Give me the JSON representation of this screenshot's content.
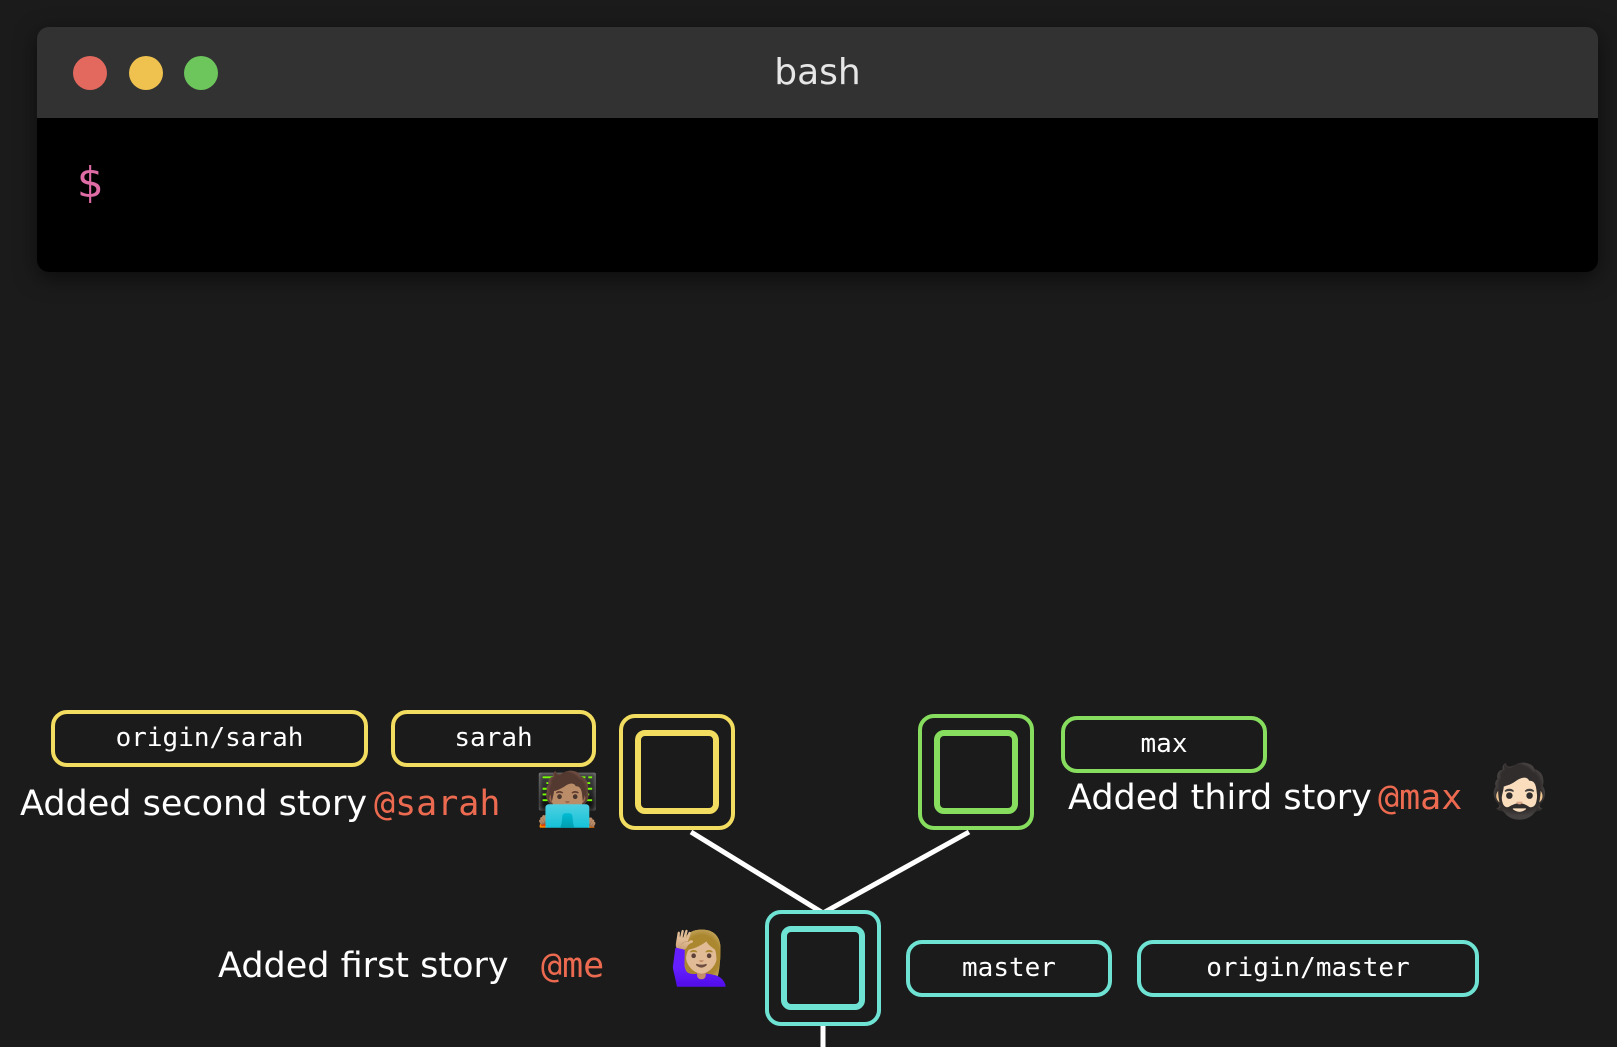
{
  "window": {
    "title": "bash",
    "prompt": "$"
  },
  "colors": {
    "prompt": "#e06ca6",
    "yellow_branch": "#f3dd60",
    "green_branch": "#86dd5e",
    "teal_branch": "#6fe3d3",
    "author": "#ec6a50",
    "edge": "#ffffff"
  },
  "commits": {
    "sarah": {
      "message": "Added second story",
      "author": "@sarah",
      "avatar": "🧑🏽‍💻",
      "avatar_icon": "woman-technologist-icon",
      "refs": [
        "origin/sarah",
        "sarah"
      ]
    },
    "max": {
      "message": "Added third story",
      "author": "@max",
      "avatar": "🧔🏻",
      "avatar_icon": "bearded-man-icon",
      "refs": [
        "max"
      ]
    },
    "root": {
      "message": "Added first story",
      "author": "@me",
      "avatar": "🙋🏼‍♀️",
      "avatar_icon": "woman-raising-hand-icon",
      "refs": [
        "master",
        "origin/master"
      ]
    }
  }
}
